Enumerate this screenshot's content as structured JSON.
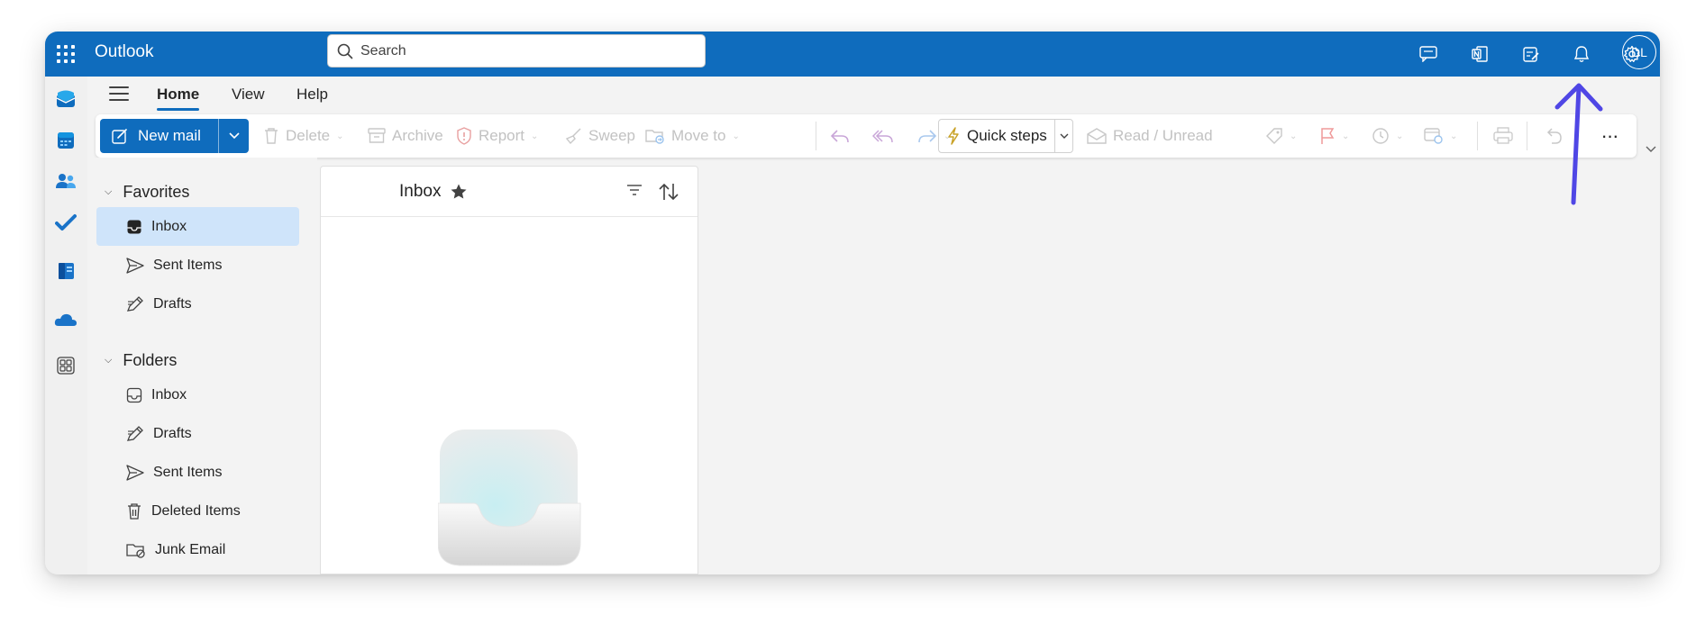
{
  "app": {
    "title": "Outlook"
  },
  "search": {
    "placeholder": "Search"
  },
  "header_icons": [
    "teams-chat-icon",
    "onenote-icon",
    "my-day-icon",
    "bell-icon",
    "gear-icon"
  ],
  "user": {
    "initials": "DL"
  },
  "left_rail": [
    "mail-icon",
    "calendar-icon",
    "people-icon",
    "todo-icon",
    "word-icon",
    "onedrive-icon",
    "apps-icon"
  ],
  "tabs": [
    {
      "label": "Home",
      "active": true
    },
    {
      "label": "View",
      "active": false
    },
    {
      "label": "Help",
      "active": false
    }
  ],
  "ribbon": {
    "new_mail": "New mail",
    "delete": "Delete",
    "archive": "Archive",
    "report": "Report",
    "sweep": "Sweep",
    "move_to": "Move to",
    "quick_steps": "Quick steps",
    "read_unread": "Read / Unread",
    "more": "···"
  },
  "favorites": {
    "title": "Favorites",
    "items": [
      {
        "label": "Inbox",
        "selected": true
      },
      {
        "label": "Sent Items",
        "selected": false
      },
      {
        "label": "Drafts",
        "selected": false
      }
    ]
  },
  "folders": {
    "title": "Folders",
    "items": [
      {
        "label": "Inbox"
      },
      {
        "label": "Drafts"
      },
      {
        "label": "Sent Items"
      },
      {
        "label": "Deleted Items"
      },
      {
        "label": "Junk Email"
      }
    ]
  },
  "message_list": {
    "title": "Inbox"
  },
  "colors": {
    "brand": "#0f6cbd",
    "selected": "#cfe4fa",
    "annotation": "#4f46e5"
  }
}
